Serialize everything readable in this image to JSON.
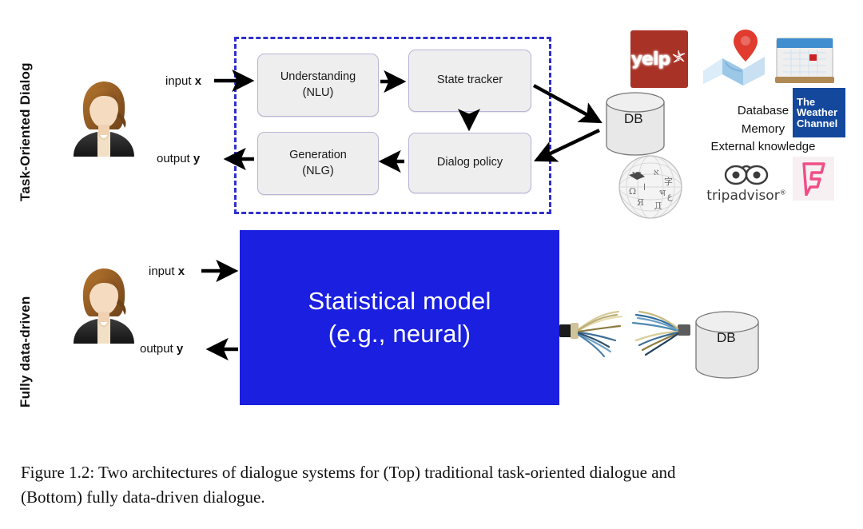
{
  "figure": {
    "caption_line1": "Figure 1.2: Two architectures of dialogue systems for (Top) traditional task-oriented dialogue and",
    "caption_line2": "(Bottom) fully data-driven dialogue."
  },
  "sections": {
    "top_label": "Task-Oriented Dialog",
    "bottom_label": "Fully data-driven"
  },
  "top_pipeline": {
    "input_label": "input ",
    "input_var": "x",
    "output_label": "output ",
    "output_var": "y",
    "boxes": [
      {
        "id": "nlu",
        "line1": "Understanding",
        "line2": "(NLU)"
      },
      {
        "id": "state_tracker",
        "line1": "State tracker",
        "line2": ""
      },
      {
        "id": "nlg",
        "line1": "Generation",
        "line2": "(NLG)"
      },
      {
        "id": "dialog_policy",
        "line1": "Dialog policy",
        "line2": ""
      }
    ],
    "db_label": "DB",
    "dashed_border_color": "#2f30cc",
    "box_fill_color": "#eeeeee",
    "box_border_color": "#b9b3d6"
  },
  "knowledge_sources": {
    "lines": [
      "Database",
      "Memory",
      "External knowledge"
    ],
    "logos": [
      {
        "name": "yelp-logo",
        "text": "yelp",
        "color": "#a93226"
      },
      {
        "name": "google-maps-logo",
        "text": ""
      },
      {
        "name": "calendar-logo",
        "text": ""
      },
      {
        "name": "weather-channel-logo",
        "line1": "The",
        "line2": "Weather",
        "line3": "Channel",
        "color": "#14489c"
      },
      {
        "name": "wikipedia-globe-logo",
        "text": ""
      },
      {
        "name": "tripadvisor-logo",
        "text": "tripadvisor",
        "superscript": "®"
      },
      {
        "name": "foursquare-logo",
        "text": "",
        "color": "#f04e86"
      }
    ]
  },
  "bottom_pipeline": {
    "input_label": "input ",
    "input_var": "x",
    "output_label": "output ",
    "output_var": "y",
    "model_line1": "Statistical model",
    "model_line2": "(e.g., neural)",
    "model_color": "#1a1fe0",
    "db_label": "DB"
  }
}
